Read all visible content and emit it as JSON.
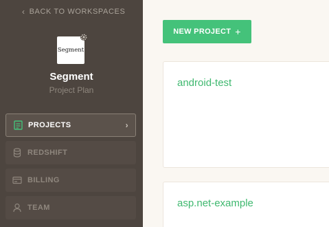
{
  "sidebar": {
    "back_label": "BACK TO WORKSPACES",
    "logo_text": "Segment",
    "workspace_name": "Segment",
    "workspace_plan": "Project Plan",
    "nav": [
      {
        "label": "PROJECTS",
        "icon": "projects-icon",
        "active": true
      },
      {
        "label": "REDSHIFT",
        "icon": "database-icon",
        "active": false
      },
      {
        "label": "BILLING",
        "icon": "billing-icon",
        "active": false
      },
      {
        "label": "TEAM",
        "icon": "user-icon",
        "active": false
      }
    ]
  },
  "main": {
    "new_project_label": "NEW PROJECT",
    "projects": [
      {
        "name": "android-test"
      },
      {
        "name": "asp.net-example"
      }
    ]
  },
  "colors": {
    "sidebar_bg": "#4d453f",
    "accent_green": "#44c27a",
    "link_green": "#3fb86f",
    "page_bg": "#faf7f2"
  }
}
